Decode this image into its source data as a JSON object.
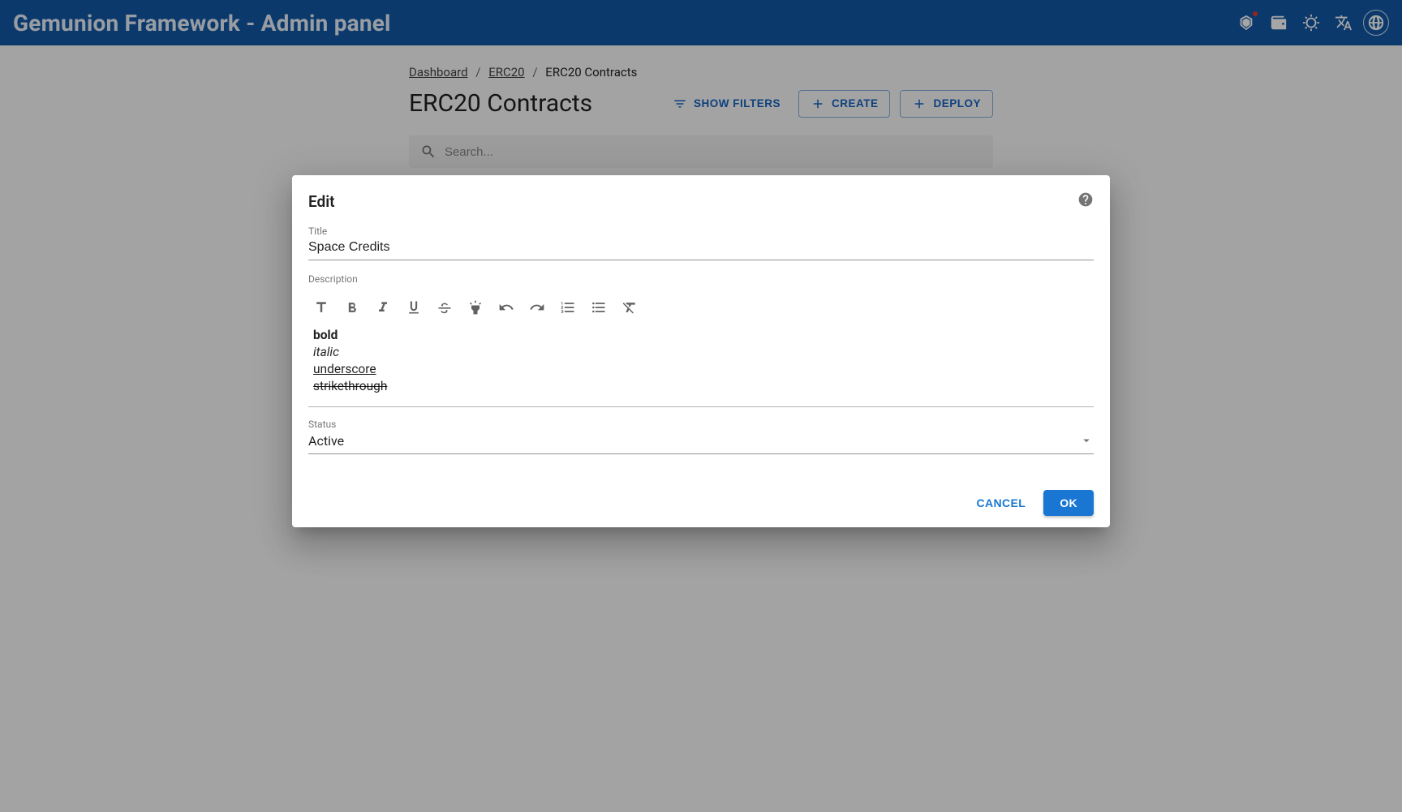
{
  "appbar": {
    "title": "Gemunion Framework - Admin panel"
  },
  "breadcrumbs": {
    "items": [
      "Dashboard",
      "ERC20",
      "ERC20 Contracts"
    ]
  },
  "page": {
    "title": "ERC20 Contracts",
    "show_filters": "SHOW FILTERS",
    "create": "CREATE",
    "deploy": "DEPLOY",
    "search_placeholder": "Search..."
  },
  "dialog": {
    "title": "Edit",
    "fields": {
      "title_label": "Title",
      "title_value": "Space Credits",
      "description_label": "Description",
      "description_content": {
        "bold": "bold",
        "italic": "italic",
        "underscore": "underscore",
        "strikethrough": "strikethrough"
      },
      "status_label": "Status",
      "status_value": "Active"
    },
    "actions": {
      "cancel": "CANCEL",
      "ok": "OK"
    }
  }
}
